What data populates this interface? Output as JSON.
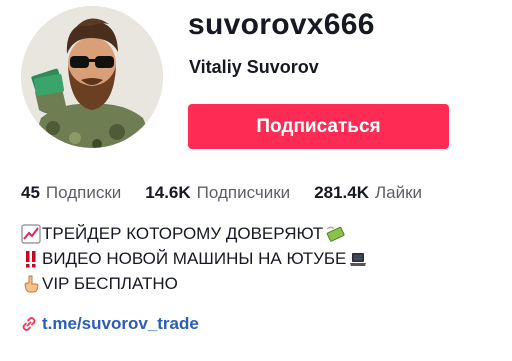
{
  "profile": {
    "username": "suvorovx666",
    "display_name": "Vitaliy Suvorov",
    "follow_label": "Подписаться"
  },
  "stats": [
    {
      "value": "45",
      "label": "Подписки"
    },
    {
      "value": "14.6K",
      "label": "Подписчики"
    },
    {
      "value": "281.4K",
      "label": "Лайки"
    }
  ],
  "bio": {
    "lines": [
      {
        "icon": "chart-increasing-icon",
        "text": "ТРЕЙДЕР КОТОРОМУ ДОВЕРЯЮТ",
        "icon_after": "money-with-wings-icon"
      },
      {
        "icon": "double-exclamation-icon",
        "text": "ВИДЕО НОВОЙ МАШИНЫ НА ЮТУБЕ",
        "icon_after": "laptop-icon"
      },
      {
        "icon": "pointing-down-icon",
        "text": "VIP БЕСПЛАТНО"
      }
    ]
  },
  "link": {
    "icon": "link-icon",
    "text": "t.me/suvorov_trade"
  },
  "colors": {
    "accent": "#fe2c55",
    "link": "#2b5db9",
    "text": "#161823",
    "secondary": "#5e5f66"
  }
}
